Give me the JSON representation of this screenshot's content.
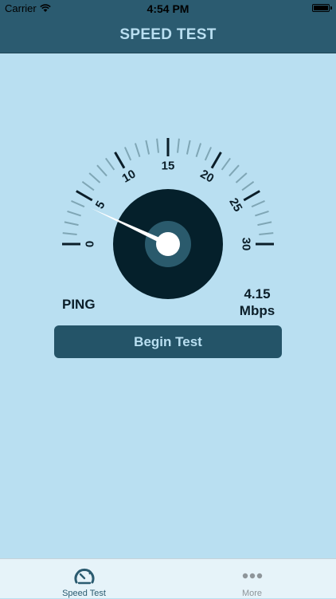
{
  "status": {
    "carrier": "Carrier",
    "time": "4:54 PM"
  },
  "nav": {
    "title": "SPEED TEST"
  },
  "gauge": {
    "min": 0,
    "max": 30,
    "value": 4.15,
    "labels": [
      "0",
      "5",
      "10",
      "15",
      "20",
      "25",
      "30"
    ]
  },
  "metrics": {
    "ping_label": "PING",
    "speed_value": "4.15",
    "speed_unit": "Mbps"
  },
  "button": {
    "label": "Begin Test"
  },
  "tabs": [
    {
      "label": "Speed Test",
      "icon": "speedometer-icon",
      "selected": true
    },
    {
      "label": "More",
      "icon": "more-dots-icon",
      "selected": false
    }
  ],
  "colors": {
    "background": "#b9dff1",
    "header": "#2b5b70",
    "button": "#245468",
    "dial": "#05202b",
    "hub_ring": "#2a5a6c",
    "needle": "#ffffff"
  }
}
